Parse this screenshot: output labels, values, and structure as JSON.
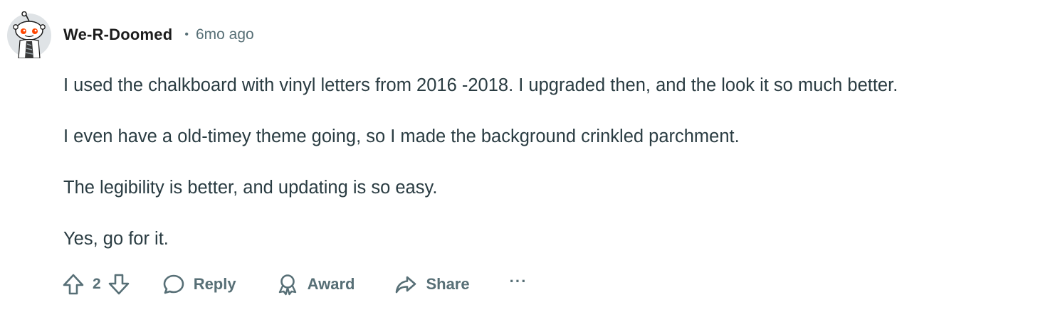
{
  "comment": {
    "author": "We-R-Doomed",
    "separator": "•",
    "timestamp": "6mo ago",
    "paragraphs": [
      "I used the chalkboard with vinyl letters from 2016 -2018. I upgraded then, and the look it so much better.",
      "I even have a old-timey theme going, so I made the background crinkled parchment.",
      "The legibility is better, and updating is so easy.",
      "Yes, go for it."
    ],
    "vote_count": "2",
    "actions": {
      "reply": "Reply",
      "award": "Award",
      "share": "Share",
      "more": "···"
    },
    "avatar_icon": "snoo-avatar-icon"
  },
  "colors": {
    "text": "#1c1c1c",
    "body_text": "#2a3c42",
    "muted": "#576f76",
    "avatar_accent": "#ff4500"
  }
}
